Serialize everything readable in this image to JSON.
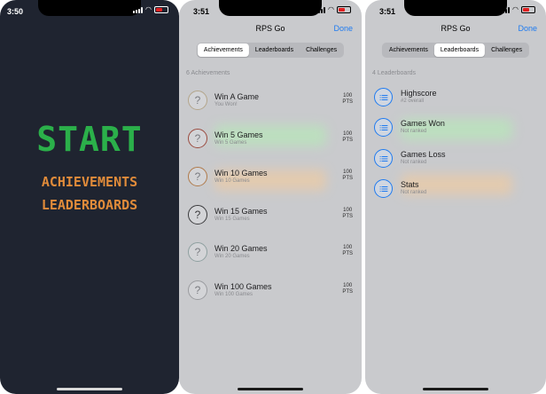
{
  "start_screen": {
    "status_time": "3:50",
    "title": "START",
    "menu": [
      "ACHIEVEMENTS",
      "LEADERBOARDS"
    ],
    "colors": {
      "background": "#1f2430",
      "title": "#2bb04a",
      "menu": "#e08b3a"
    }
  },
  "achievements_screen": {
    "status_time": "3:51",
    "header": {
      "title": "RPS Go",
      "done_label": "Done"
    },
    "tabs": [
      {
        "label": "Achievements",
        "active": true
      },
      {
        "label": "Leaderboards",
        "active": false
      },
      {
        "label": "Challenges",
        "active": false
      }
    ],
    "section_label": "6 Achievements",
    "items": [
      {
        "title": "Win A Game",
        "subtitle": "You Won!",
        "points": "100",
        "points_unit": "PTS"
      },
      {
        "title": "Win 5 Games",
        "subtitle": "Win 5 Games",
        "points": "100",
        "points_unit": "PTS"
      },
      {
        "title": "Win 10 Games",
        "subtitle": "Win 10 Games",
        "points": "100",
        "points_unit": "PTS"
      },
      {
        "title": "Win 15 Games",
        "subtitle": "Win 15 Games",
        "points": "100",
        "points_unit": "PTS"
      },
      {
        "title": "Win 20 Games",
        "subtitle": "Win 20 Games",
        "points": "100",
        "points_unit": "PTS"
      },
      {
        "title": "Win 100 Games",
        "subtitle": "Win 100 Games",
        "points": "100",
        "points_unit": "PTS"
      }
    ],
    "badge_glyph": "?"
  },
  "leaderboards_screen": {
    "status_time": "3:51",
    "header": {
      "title": "RPS Go",
      "done_label": "Done"
    },
    "tabs": [
      {
        "label": "Achievements",
        "active": false
      },
      {
        "label": "Leaderboards",
        "active": true
      },
      {
        "label": "Challenges",
        "active": false
      }
    ],
    "section_label": "4 Leaderboards",
    "items": [
      {
        "title": "Highscore",
        "subtitle": "#2 overall"
      },
      {
        "title": "Games Won",
        "subtitle": "Not ranked"
      },
      {
        "title": "Games Loss",
        "subtitle": "Not ranked"
      },
      {
        "title": "Stats",
        "subtitle": "Not ranked"
      }
    ],
    "accent_color": "#1f7bf0"
  }
}
